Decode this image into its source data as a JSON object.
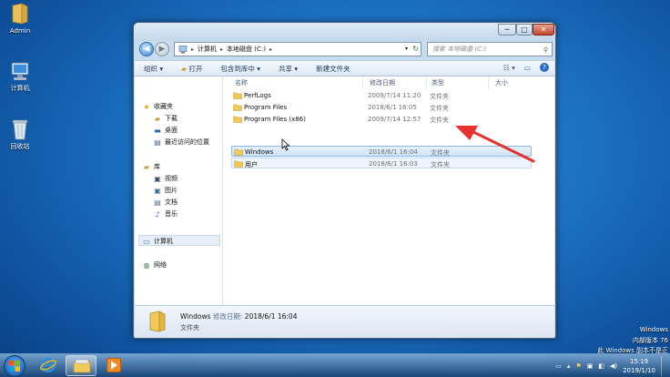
{
  "desktop": {
    "icons": [
      {
        "label": "Admin"
      },
      {
        "label": "计算机"
      },
      {
        "label": "回收站"
      }
    ],
    "watermark": {
      "line1": "Windows",
      "line2": "内部版本 76",
      "line3": "此 Windows 副本不是正"
    }
  },
  "window": {
    "controls": {
      "minimize": "─",
      "maximize": "□",
      "close": "✕"
    },
    "address": {
      "segments": [
        "计算机",
        "本地磁盘 (C:)"
      ],
      "separator": "▸",
      "dropdown": "▾",
      "refresh": "↻"
    },
    "search_placeholder": "搜索 本地磁盘 (C:)",
    "toolbar": {
      "organize": "组织 ▾",
      "open": "打开",
      "include": "包含到库中 ▾",
      "share": "共享 ▾",
      "new_folder": "新建文件夹"
    },
    "sidebar": {
      "favorites": "收藏夹",
      "downloads": "下载",
      "desktop": "桌面",
      "recent": "最近访问的位置",
      "libraries": "库",
      "videos": "视频",
      "pictures": "图片",
      "documents": "文档",
      "music": "音乐",
      "computer": "计算机",
      "network": "网络"
    },
    "columns": {
      "name": "名称",
      "date": "修改日期",
      "type": "类型",
      "size": "大小"
    },
    "rows": [
      {
        "name": "PerfLogs",
        "date": "2009/7/14 11:20",
        "type": "文件夹"
      },
      {
        "name": "Program Files",
        "date": "2018/6/1 16:05",
        "type": "文件夹"
      },
      {
        "name": "Program Files (x86)",
        "date": "2009/7/14 12:57",
        "type": "文件夹"
      },
      {
        "name": "Windows",
        "date": "2018/6/1 16:04",
        "type": "文件夹"
      },
      {
        "name": "用户",
        "date": "2018/6/1 16:03",
        "type": "文件夹"
      }
    ],
    "details": {
      "name": "Windows",
      "date_label": "修改日期:",
      "date": "2018/6/1 16:04",
      "type": "文件夹"
    }
  },
  "taskbar": {
    "time": "15:19",
    "date": "2019/1/10"
  },
  "colors": {
    "desktop_bg": "#1b6fc0",
    "annotation_arrow": "#e8322f",
    "selection": "#cfe4f9"
  }
}
